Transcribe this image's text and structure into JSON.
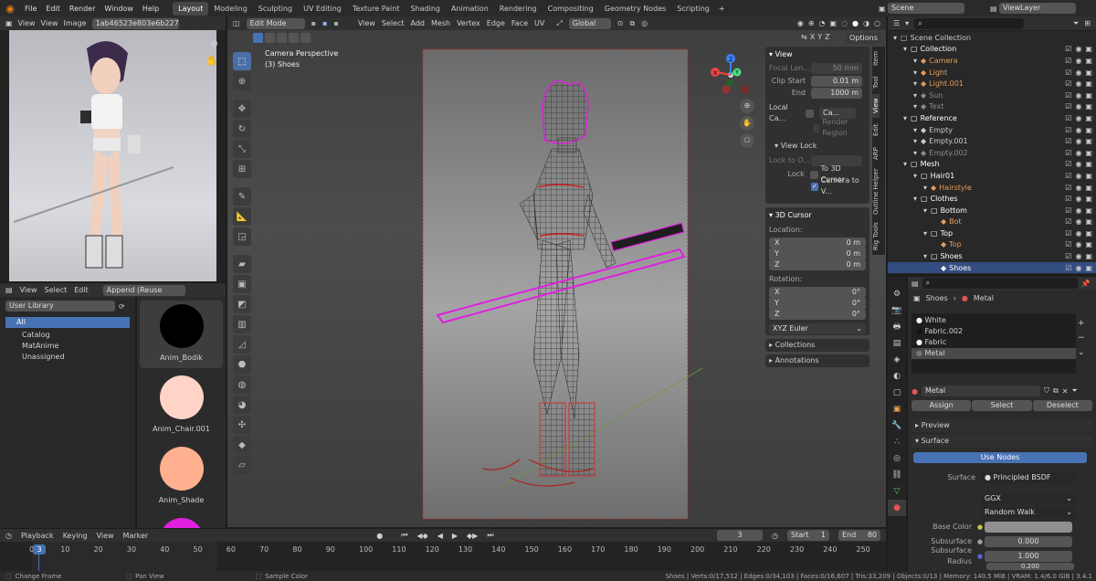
{
  "topbar": {
    "menus": [
      "File",
      "Edit",
      "Render",
      "Window",
      "Help"
    ],
    "workspaces": [
      "Layout",
      "Modeling",
      "Sculpting",
      "UV Editing",
      "Texture Paint",
      "Shading",
      "Animation",
      "Rendering",
      "Compositing",
      "Geometry Nodes",
      "Scripting"
    ],
    "scene": "Scene",
    "viewlayer": "ViewLayer"
  },
  "image_editor": {
    "menus": [
      "View",
      "Image"
    ],
    "view_label": "View",
    "image_name": "1ab46523e803e6b2270e..."
  },
  "asset_browser": {
    "menus": [
      "View",
      "Select",
      "Edit"
    ],
    "import_mode": "Append (Reuse Data)",
    "library": "User Library",
    "categories": [
      "All",
      "Catalog",
      "MatAnime",
      "Unassigned"
    ],
    "assets": [
      {
        "name": "Anim_Bodik",
        "color": "#000000"
      },
      {
        "name": "Anim_Chair.001",
        "color": "#ffd4c6"
      },
      {
        "name": "Anim_Shade",
        "color": "#ffb08e"
      },
      {
        "name": "",
        "color": "#e020e0"
      }
    ]
  },
  "viewport": {
    "mode": "Edit Mode",
    "menus": [
      "View",
      "Select",
      "Add",
      "Mesh",
      "Vertex",
      "Edge",
      "Face",
      "UV"
    ],
    "orientation": "Global",
    "camera_label": "Camera Perspective",
    "object_label": "(3) Shoes",
    "options": "Options",
    "xyz": [
      "X",
      "Y",
      "Z"
    ],
    "npanel": {
      "view_title": "View",
      "focal_label": "Focal Len...",
      "focal": "50 mm",
      "clip_start_label": "Clip Start",
      "clip_start": "0.01 m",
      "end_label": "End",
      "end": "1000 m",
      "local_camera": "Local Ca...",
      "camera_field": "Ca...",
      "render_region": "Render Region",
      "view_lock": "View Lock",
      "lock_to": "Lock to O...",
      "lock": "Lock",
      "to_3d_cursor": "To 3D Cursor",
      "camera_to_view": "Camera to V...",
      "cursor_title": "3D Cursor",
      "location": "Location:",
      "loc": [
        {
          "axis": "X",
          "value": "0 m"
        },
        {
          "axis": "Y",
          "value": "0 m"
        },
        {
          "axis": "Z",
          "value": "0 m"
        }
      ],
      "rotation": "Rotation:",
      "rot": [
        {
          "axis": "X",
          "value": "0°"
        },
        {
          "axis": "Y",
          "value": "0°"
        },
        {
          "axis": "Z",
          "value": "0°"
        }
      ],
      "euler": "XYZ Euler",
      "collections": "Collections",
      "annotations": "Annotations"
    },
    "tabs": [
      "Item",
      "Tool",
      "View",
      "Edit",
      "ARP",
      "Outline Helper",
      "Rig Tools"
    ]
  },
  "outliner": {
    "rows": [
      {
        "name": "Scene Collection",
        "indent": 0,
        "color": "#cccccc"
      },
      {
        "name": "Collection",
        "indent": 1,
        "color": "#ffffff"
      },
      {
        "name": "Camera",
        "indent": 2,
        "color": "#e79b5a"
      },
      {
        "name": "Light",
        "indent": 2,
        "color": "#e79b5a"
      },
      {
        "name": "Light.001",
        "indent": 2,
        "color": "#e79b5a"
      },
      {
        "name": "Sun",
        "indent": 2,
        "color": "#8a8a8a"
      },
      {
        "name": "Text",
        "indent": 2,
        "color": "#8a8a8a"
      },
      {
        "name": "Reference",
        "indent": 1,
        "color": "#ffffff"
      },
      {
        "name": "Empty",
        "indent": 2,
        "color": "#cccccc"
      },
      {
        "name": "Empty.001",
        "indent": 2,
        "color": "#cccccc"
      },
      {
        "name": "Empty.002",
        "indent": 2,
        "color": "#8a8a8a"
      },
      {
        "name": "Mesh",
        "indent": 1,
        "color": "#ffffff"
      },
      {
        "name": "Hair01",
        "indent": 2,
        "color": "#ffffff"
      },
      {
        "name": "Hairstyle",
        "indent": 3,
        "color": "#e79b5a"
      },
      {
        "name": "Clothes",
        "indent": 2,
        "color": "#ffffff"
      },
      {
        "name": "Bottom",
        "indent": 3,
        "color": "#ffffff"
      },
      {
        "name": "Bot",
        "indent": 4,
        "color": "#e79b5a"
      },
      {
        "name": "Top",
        "indent": 3,
        "color": "#ffffff"
      },
      {
        "name": "Top",
        "indent": 4,
        "color": "#e79b5a"
      },
      {
        "name": "Shoes",
        "indent": 3,
        "color": "#ffffff"
      },
      {
        "name": "Shoes",
        "indent": 4,
        "color": "#ffffff"
      }
    ]
  },
  "properties": {
    "breadcrumb_object": "Shoes",
    "breadcrumb_material": "Metal",
    "slots": [
      "White",
      "Fabric.002",
      "Fabric",
      "Metal"
    ],
    "material_name": "Metal",
    "assign": "Assign",
    "select": "Select",
    "deselect": "Deselect",
    "preview": "Preview",
    "surface": "Surface",
    "use_nodes": "Use Nodes",
    "surface_label": "Surface",
    "surface_value": "Principled BSDF",
    "ggx": "GGX",
    "random_walk": "Random Walk",
    "base_color_label": "Base Color",
    "subsurface_label": "Subsurface",
    "subsurface_value": "0.000",
    "radius_label": "Subsurface Radius",
    "radius_value": "1.000",
    "radius_value2": "0.200"
  },
  "timeline": {
    "menus": [
      "Playback",
      "Keying",
      "View",
      "Marker"
    ],
    "current_frame": "3",
    "start_label": "Start",
    "start": "1",
    "end_label": "End",
    "end": "80",
    "ticks": [
      "0",
      "10",
      "20",
      "30",
      "40",
      "50",
      "60",
      "70",
      "80",
      "90",
      "100",
      "110",
      "120",
      "130",
      "140",
      "150",
      "160",
      "170",
      "180",
      "190",
      "200",
      "210",
      "220",
      "230",
      "240",
      "250"
    ],
    "frame_badge": "3"
  },
  "statusbar": {
    "change_frame": "Change Frame",
    "pan_view": "Pan View",
    "sample_color": "Sample Color",
    "stats": "Shoes | Verts:0/17,512 | Edges:0/34,103 | Faces:0/16,607 | Tris:33,209 | Objects:0/13 | Memory: 140.5 MiB | VRAM: 1.4/6.0 GiB | 3.4.1"
  }
}
